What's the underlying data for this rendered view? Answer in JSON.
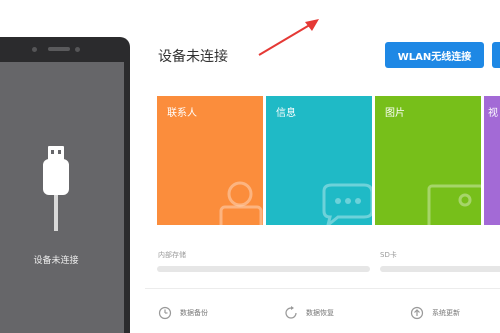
{
  "phone": {
    "status_text": "设备未连接"
  },
  "header": {
    "title": "设备未连接",
    "wlan_button": "WLAN无线连接"
  },
  "tiles": [
    {
      "label": "联系人",
      "color": "#fb8d3c",
      "icon": "contact-card-icon"
    },
    {
      "label": "信息",
      "color": "#1fbac6",
      "icon": "chat-bubbles-icon"
    },
    {
      "label": "图片",
      "color": "#77bf1a",
      "icon": "picture-frame-icon"
    },
    {
      "label": "视",
      "color": "#a36ad6",
      "icon": "video-icon"
    }
  ],
  "storage": {
    "internal_label": "内部存储",
    "sd_label": "SD卡"
  },
  "actions": [
    {
      "label": "数据备份",
      "icon": "backup-clock-icon"
    },
    {
      "label": "数据恢复",
      "icon": "restore-icon"
    },
    {
      "label": "系统更新",
      "icon": "update-arrow-icon"
    }
  ],
  "colors": {
    "accent": "#1e88e5",
    "annotation_arrow": "#e53935"
  }
}
